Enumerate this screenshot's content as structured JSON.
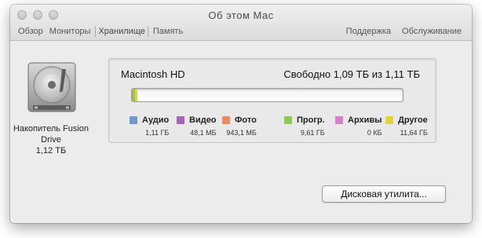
{
  "window": {
    "title": "Об этом Mac"
  },
  "tabs": [
    {
      "label": "Обзор",
      "active": false
    },
    {
      "label": "Мониторы",
      "active": false
    },
    {
      "label": "Хранилище",
      "active": true
    },
    {
      "label": "Память",
      "active": false
    }
  ],
  "tabs_right": [
    {
      "label": "Поддержка"
    },
    {
      "label": "Обслуживание"
    }
  ],
  "drive": {
    "label_line1": "Накопитель Fusion",
    "label_line2": "Drive",
    "capacity": "1,12 ТБ",
    "icon": "hard-drive-icon"
  },
  "volume": {
    "name": "Macintosh HD",
    "free_text": "Свободно 1,09 ТБ из 1,11 ТБ"
  },
  "usage": [
    {
      "key": "audio",
      "label": "Аудио",
      "size": "1,11 ГБ",
      "color": "#6f98cf",
      "fraction": 0.001
    },
    {
      "key": "video",
      "label": "Видео",
      "size": "48,1 МБ",
      "color": "#a565b8",
      "fraction": 0.0001
    },
    {
      "key": "photo",
      "label": "Фото",
      "size": "943,1 МБ",
      "color": "#e98a62",
      "fraction": 0.0008
    },
    {
      "key": "apps",
      "label": "Прогр.",
      "size": "9,61 ГБ",
      "color": "#8ccc56",
      "fraction": 0.0086
    },
    {
      "key": "archives",
      "label": "Архивы",
      "size": "0 КБ",
      "color": "#d77fc8",
      "fraction": 0
    },
    {
      "key": "other",
      "label": "Другое",
      "size": "11,64 ГБ",
      "color": "#e2d23b",
      "fraction": 0.0105
    }
  ],
  "buttons": {
    "disk_utility": "Дисковая утилита..."
  }
}
